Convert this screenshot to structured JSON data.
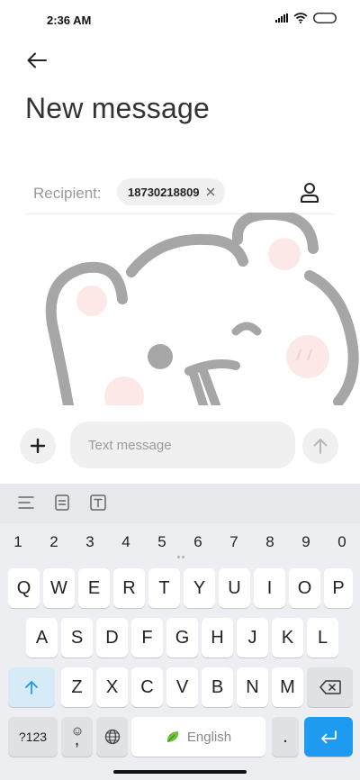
{
  "status_bar": {
    "time": "2:36 AM",
    "icons": [
      "signal-icon",
      "wifi-icon",
      "battery-icon"
    ]
  },
  "header": {
    "back_icon": "back-arrow-icon",
    "title": "New message"
  },
  "recipient": {
    "label": "Recipient:",
    "chips": [
      {
        "number": "18730218809",
        "remove_icon": "close-icon"
      }
    ],
    "contact_icon": "contact-person-icon"
  },
  "background_art": {
    "description_icon": "bear-illustration",
    "stroke_color": "#a6a6a6",
    "blush_color": "#fde8e8"
  },
  "compose": {
    "add_icon": "plus-icon",
    "placeholder": "Text message",
    "value": "",
    "send_icon": "send-arrow-icon"
  },
  "keyboard": {
    "toolbar_icons": [
      "text-align-icon",
      "clipboard-icon",
      "text-format-icon"
    ],
    "number_row": [
      "1",
      "2",
      "3",
      "4",
      "5",
      "6",
      "7",
      "8",
      "9",
      "0"
    ],
    "row1": [
      "Q",
      "W",
      "E",
      "R",
      "T",
      "Y",
      "U",
      "I",
      "O",
      "P"
    ],
    "row2": [
      "A",
      "S",
      "D",
      "F",
      "G",
      "H",
      "J",
      "K",
      "L"
    ],
    "row3": [
      "Z",
      "X",
      "C",
      "V",
      "B",
      "N",
      "M"
    ],
    "shift_icon": "shift-arrow-icon",
    "backspace_icon": "backspace-icon",
    "symbols_label": "?123",
    "comma_label": ",",
    "emoji_icon": "emoji-icon",
    "globe_icon": "globe-icon",
    "space_label": "English",
    "space_icon": "leaf-icon",
    "period_label": ".",
    "enter_icon": "enter-icon",
    "accent_color": "#1e9af0"
  }
}
